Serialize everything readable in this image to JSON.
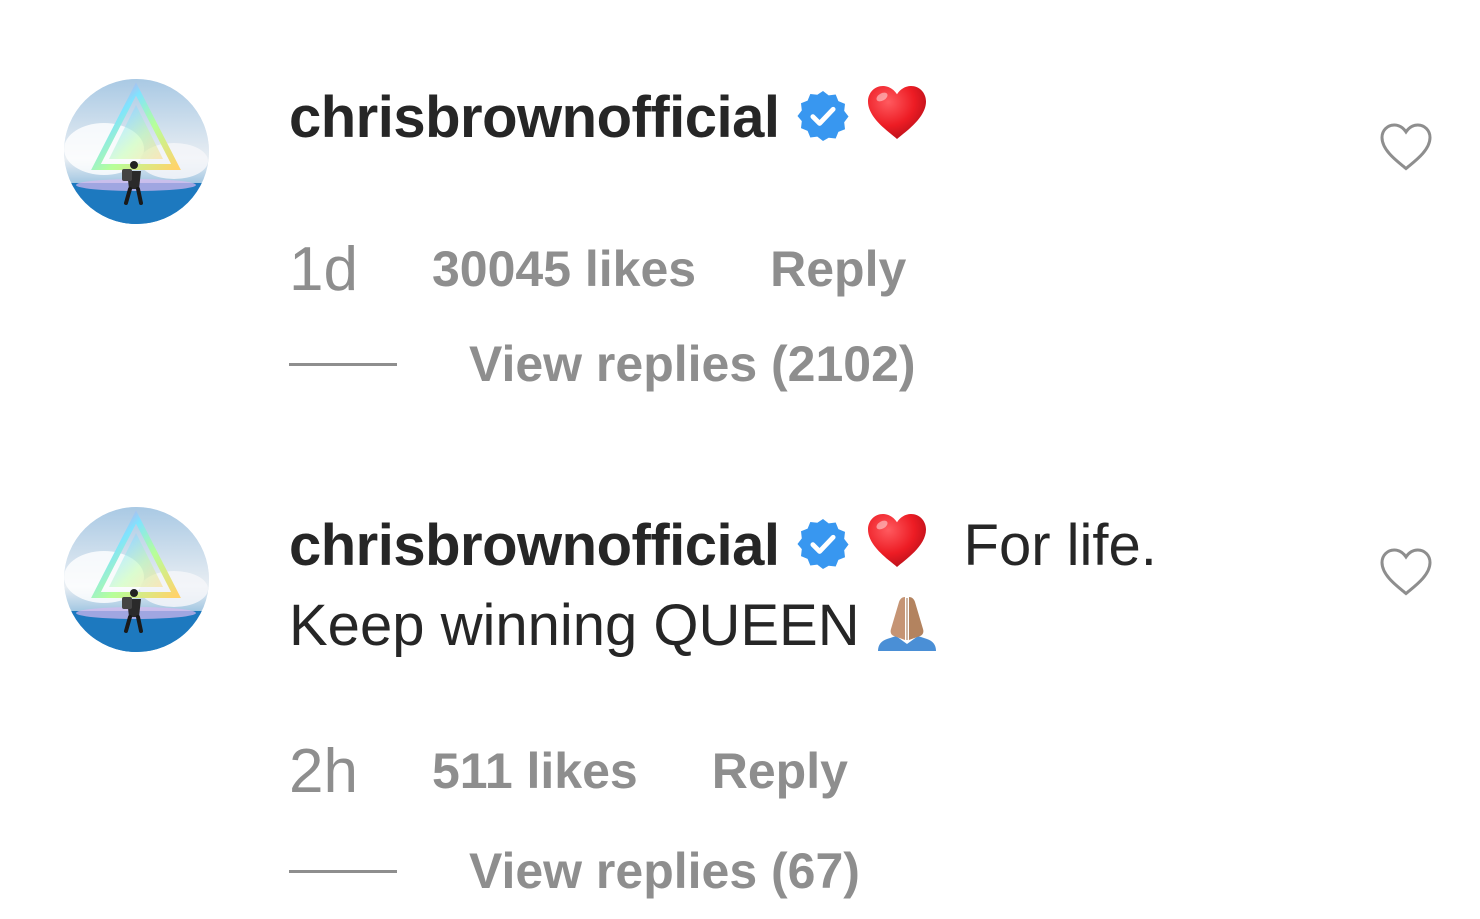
{
  "comments": [
    {
      "username": "chrisbrownofficial",
      "verified": true,
      "emoji": "heart",
      "text_line1": "",
      "text_line2": "",
      "ends_with_emoji": "",
      "time": "1d",
      "likes": "30045 likes",
      "reply_label": "Reply",
      "view_replies": "View replies (2102)"
    },
    {
      "username": "chrisbrownofficial",
      "verified": true,
      "emoji": "heart",
      "text_line1": "For life.",
      "text_line2": "Keep winning QUEEN",
      "ends_with_emoji": "folded-hands",
      "time": "2h",
      "likes": "511 likes",
      "reply_label": "Reply",
      "view_replies": "View replies (67)"
    }
  ],
  "colors": {
    "text_primary": "#262626",
    "text_secondary": "#8e8e8e",
    "verified_blue": "#3897f0",
    "heart_red": "#ed1c24"
  },
  "icons": {
    "verified": "verified-badge-icon",
    "like": "heart-outline-icon",
    "emoji_heart": "red-heart-emoji-icon",
    "emoji_pray": "folded-hands-emoji-icon"
  }
}
